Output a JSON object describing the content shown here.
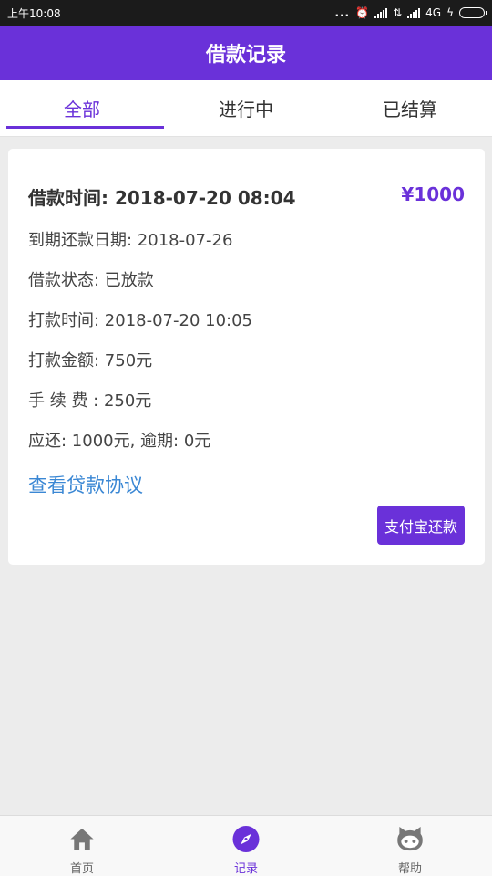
{
  "status_bar": {
    "time": "上午10:08",
    "network": "4G",
    "dots": "..."
  },
  "header": {
    "title": "借款记录"
  },
  "tabs": [
    {
      "label": "全部",
      "active": true
    },
    {
      "label": "进行中",
      "active": false
    },
    {
      "label": "已结算",
      "active": false
    }
  ],
  "record": {
    "title": "借款时间: 2018-07-20 08:04",
    "amount": "¥1000",
    "details": [
      "到期还款日期: 2018-07-26",
      "借款状态: 已放款",
      "打款时间: 2018-07-20 10:05",
      "打款金额: 750元",
      "手 续 费 : 250元",
      "应还: 1000元, 逾期: 0元"
    ],
    "agreement_link": "查看贷款协议",
    "pay_button": "支付宝还款"
  },
  "bottom_nav": [
    {
      "label": "首页",
      "icon": "home-icon",
      "active": false
    },
    {
      "label": "记录",
      "icon": "compass-icon",
      "active": true
    },
    {
      "label": "帮助",
      "icon": "github-cat-icon",
      "active": false
    }
  ],
  "colors": {
    "accent": "#6a31d9",
    "link": "#3a87d4",
    "background": "#ececec"
  }
}
